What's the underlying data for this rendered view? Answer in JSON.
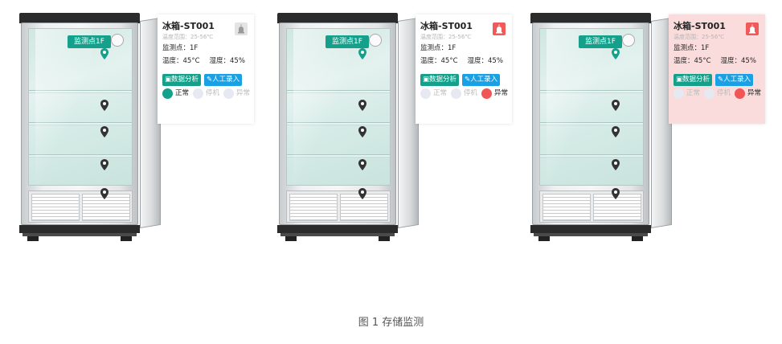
{
  "units": [
    {
      "title": "冰箱-ST001",
      "range": "温度范围：25-56℃",
      "point_label": "监测点：1F",
      "temp": "温度：45°C",
      "humidity": "湿度：45%",
      "btn_analysis": "数据分析",
      "btn_manual": "人工录入",
      "status_normal": "正常",
      "status_stop": "停机",
      "status_abnormal": "异常",
      "active_status": "normal",
      "card_bg": "#ffffff",
      "tag": "监测点1F"
    },
    {
      "title": "冰箱-ST001",
      "range": "温度范围：25-56℃",
      "point_label": "监测点：1F",
      "temp": "温度：45°C",
      "humidity": "湿度：45%",
      "btn_analysis": "数据分析",
      "btn_manual": "人工录入",
      "status_normal": "正常",
      "status_stop": "停机",
      "status_abnormal": "异常",
      "active_status": "abnormal",
      "card_bg": "#ffffff",
      "tag": "监测点1F"
    },
    {
      "title": "冰箱-ST001",
      "range": "温度范围：25-56℃",
      "point_label": "监测点：1F",
      "temp": "温度：45°C",
      "humidity": "湿度：45%",
      "btn_analysis": "数据分析",
      "btn_manual": "人工录入",
      "status_normal": "正常",
      "status_stop": "停机",
      "status_abnormal": "异常",
      "active_status": "abnormal",
      "card_bg": "#fbdcdc",
      "tag": "监测点1F"
    }
  ],
  "caption": "图 1 存储监测",
  "colors": {
    "accent_green": "#14a08a",
    "accent_blue": "#1aa0e4",
    "alarm_red": "#f05656"
  },
  "icons": {
    "device_icon": "alarm-lamp-icon",
    "pin_icon": "map-pin-icon",
    "analysis_icon": "chart-doc-icon",
    "manual_icon": "pen-icon"
  }
}
